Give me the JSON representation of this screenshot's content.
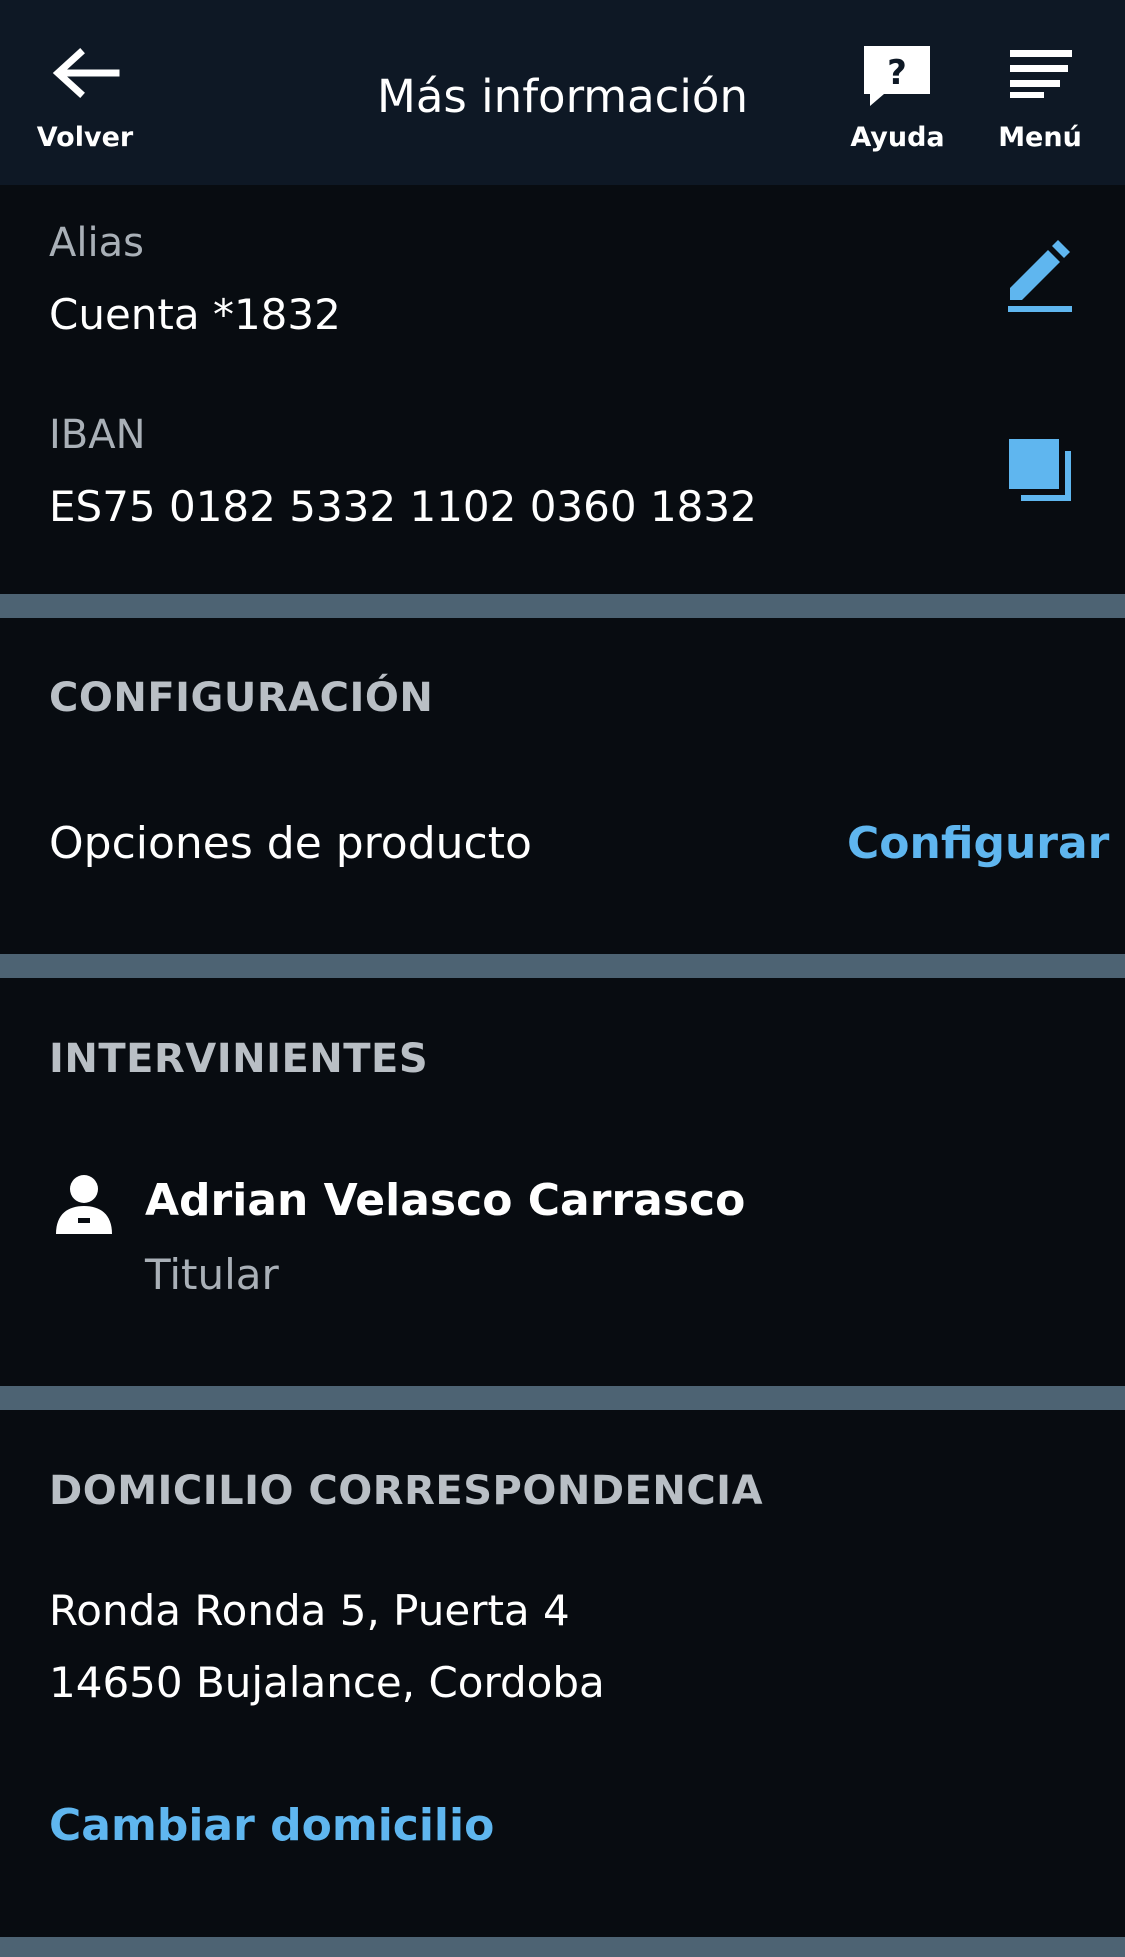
{
  "header": {
    "title": "Más información",
    "back_label": "Volver",
    "help_label": "Ayuda",
    "menu_label": "Menú"
  },
  "account": {
    "alias_label": "Alias",
    "alias_value": "Cuenta *1832",
    "iban_label": "IBAN",
    "iban_value": "ES75 0182 5332 1102 0360 1832"
  },
  "configuracion": {
    "title": "CONFIGURACIÓN",
    "row_label": "Opciones de producto",
    "action_label": "Configurar"
  },
  "intervinientes": {
    "title": "INTERVINIENTES",
    "person_name": "Adrian Velasco Carrasco",
    "person_role": "Titular"
  },
  "domicilio": {
    "title": "DOMICILIO CORRESPONDENCIA",
    "line1": "Ronda Ronda 5, Puerta 4",
    "line2": "14650 Bujalance, Cordoba",
    "action_label": "Cambiar domicilio"
  },
  "colors": {
    "header_bg": "#0e1825",
    "page_bg": "#080c11",
    "divider": "#4d6373",
    "accent": "#5fb6ef"
  },
  "icons": {
    "back": "arrow-left-icon",
    "help": "question-bubble-icon",
    "menu": "hamburger-menu-icon",
    "edit": "pencil-icon",
    "copy": "copy-icon",
    "person": "person-icon"
  }
}
